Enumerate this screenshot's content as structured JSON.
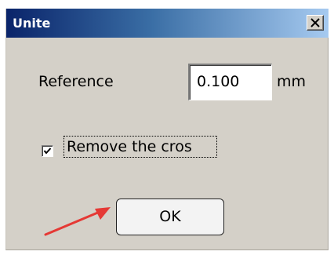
{
  "window": {
    "title": "Unite",
    "close_glyph": "×"
  },
  "form": {
    "reference_label": "Reference",
    "reference_value": "0.100",
    "unit": "mm",
    "checkbox_label": "Remove the cros",
    "checkbox_checked": true
  },
  "buttons": {
    "ok_label": "OK"
  },
  "colors": {
    "titlebar_start": "#0a246a",
    "titlebar_end": "#a6caf0",
    "dialog_bg": "#d4d0c8",
    "annotation_arrow": "#e53935"
  },
  "icons": {
    "close": "close-icon",
    "check": "checkmark-icon",
    "annotation": "red-arrow-icon"
  }
}
